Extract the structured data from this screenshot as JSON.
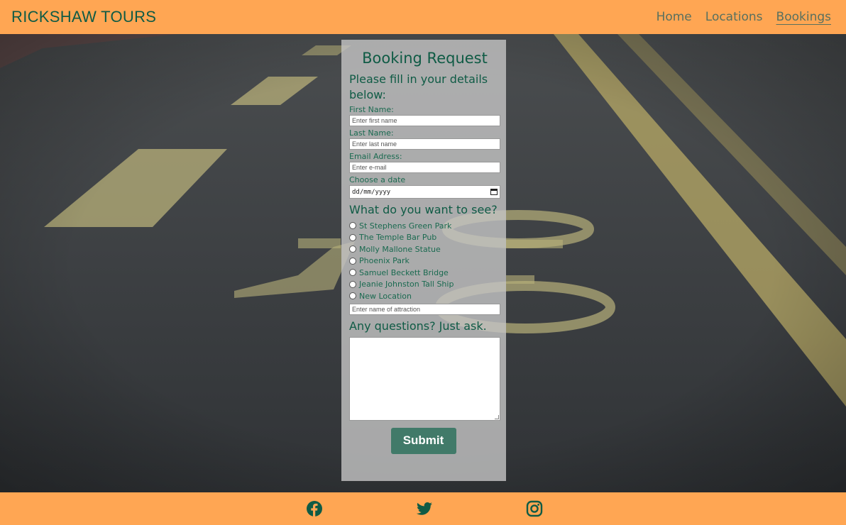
{
  "header": {
    "brand": "RICKSHAW TOURS",
    "nav": [
      {
        "label": "Home"
      },
      {
        "label": "Locations"
      },
      {
        "label": "Bookings",
        "active": true
      }
    ]
  },
  "form": {
    "title": "Booking Request",
    "subtitle": "Please fill in your details below:",
    "first_name": {
      "label": "First Name:",
      "placeholder": "Enter first name"
    },
    "last_name": {
      "label": "Last Name:",
      "placeholder": "Enter last name"
    },
    "email": {
      "label": "Email Adress:",
      "placeholder": "Enter e-mail"
    },
    "date": {
      "label": "Choose a date",
      "placeholder": "dd/mm/yyyy"
    },
    "attractions_heading": "What do you want to see?",
    "attractions": [
      "St Stephens Green Park",
      "The Temple Bar Pub",
      "Molly Mallone Statue",
      "Phoenix Park",
      "Samuel Beckett Bridge",
      "Jeanie Johnston Tall Ship",
      "New Location"
    ],
    "new_location_placeholder": "Enter name of attraction",
    "questions_heading": "Any questions? Just ask.",
    "submit_label": "Submit"
  },
  "footer": {
    "social_icons": [
      "facebook-icon",
      "twitter-icon",
      "instagram-icon"
    ]
  },
  "colors": {
    "header_bg": "#ffa653",
    "brand_green": "#0f5b45",
    "submit_bg": "#417a69"
  }
}
